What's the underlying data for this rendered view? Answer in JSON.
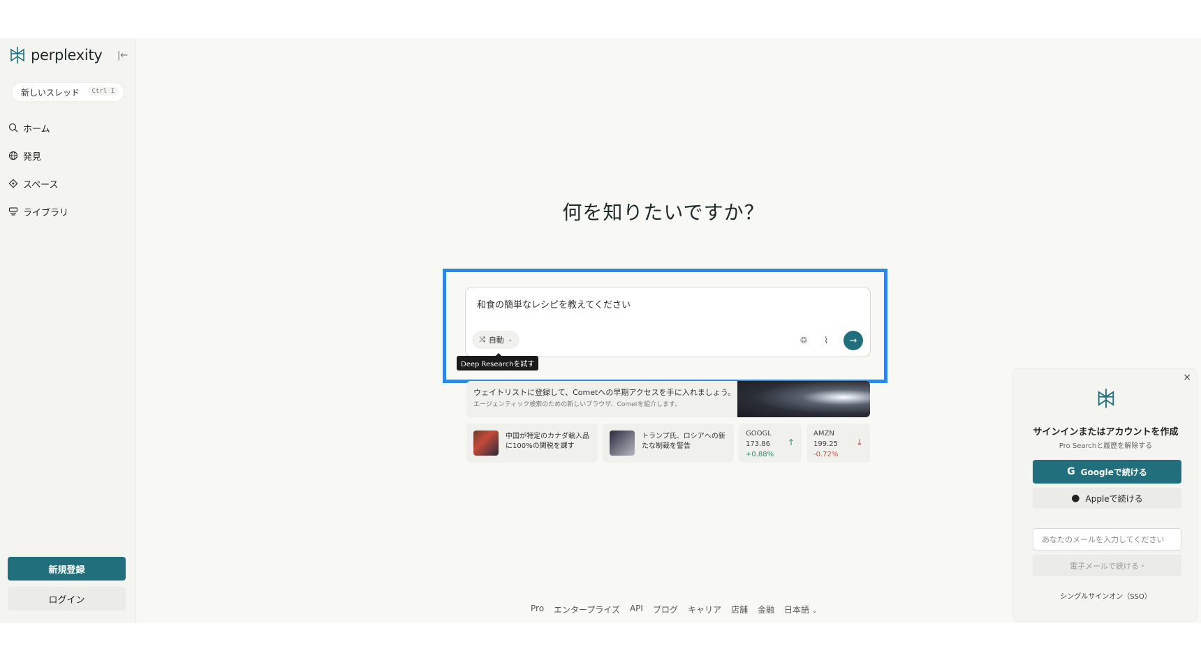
{
  "app": {
    "name": "perplexity"
  },
  "sidebar": {
    "new_thread": "新しいスレッド",
    "shortcut": "Ctrl I",
    "items": [
      {
        "label": "ホーム",
        "icon": "search-icon"
      },
      {
        "label": "発見",
        "icon": "globe-icon"
      },
      {
        "label": "スペース",
        "icon": "spaces-icon"
      },
      {
        "label": "ライブラリ",
        "icon": "library-icon"
      }
    ],
    "signup": "新規登録",
    "login": "ログイン"
  },
  "main": {
    "headline": "何を知りたいですか？",
    "query": "和食の簡単なレシピを教えてください",
    "mode": "自動",
    "tooltip": "Deep Researchを試す",
    "banner": {
      "title": "ウェイトリストに登録して、Cometへの早期アクセスを手に入れましょう。",
      "subtitle": "エージェンティック検索のための新しいブラウザ、Cometを紹介します。"
    },
    "news": [
      {
        "text": "中国が特定のカナダ輸入品に100%の関税を課す"
      },
      {
        "text": "トランプ氏、ロシアへの新たな制裁を警告"
      }
    ],
    "stocks": [
      {
        "ticker": "GOOGL",
        "price": "173.86",
        "change": "+0.88%",
        "direction": "up"
      },
      {
        "ticker": "AMZN",
        "price": "199.25",
        "change": "-0.72%",
        "direction": "down"
      }
    ]
  },
  "footer": {
    "links": [
      "Pro",
      "エンタープライズ",
      "API",
      "ブログ",
      "キャリア",
      "店舗",
      "金融",
      "日本語"
    ]
  },
  "modal": {
    "title": "サインインまたはアカウントを作成",
    "subtitle": "Pro Searchと履歴を解除する",
    "google": "Googleで続ける",
    "apple": "Appleで続ける",
    "email_placeholder": "あなたのメールを入力してください",
    "email_button": "電子メールで続ける",
    "sso": "シングルサインオン（SSO）"
  },
  "colors": {
    "accent": "#216f7c",
    "highlight": "#2d8ae0"
  }
}
